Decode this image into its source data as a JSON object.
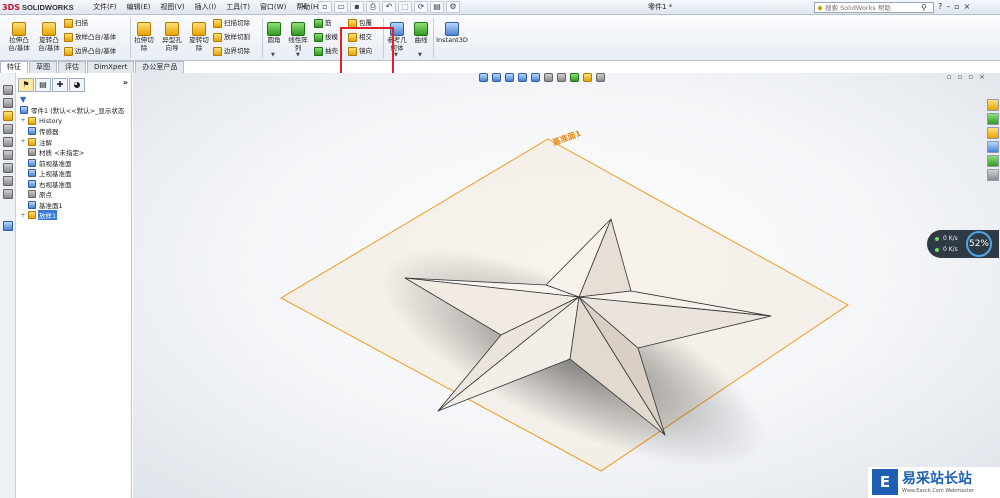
{
  "app": {
    "logo_ds": "3DS",
    "logo_text": "SOLIDWORKS",
    "document_title": "零件1 *"
  },
  "menu": [
    "文件(F)",
    "编辑(E)",
    "视图(V)",
    "插入(I)",
    "工具(T)",
    "窗口(W)",
    "帮助(H)"
  ],
  "menu_more": "⇲",
  "search": {
    "placeholder": "搜索 SolidWorks 帮助"
  },
  "commands": {
    "extrude_boss": "拉伸凸\n台/基体",
    "revolve_boss": "旋转凸\n台/基体",
    "sweep": "扫描",
    "loft_boss": "放样凸台/基体",
    "boundary_boss": "边界凸台/基体",
    "extrude_cut": "拉伸切\n除",
    "hole_wizard": "异型孔\n向导",
    "revolve_cut": "旋转切\n除",
    "swept_cut": "扫描切除",
    "lofted_cut": "放样切割",
    "boundary_cut": "边界切除",
    "fillet": "圆角",
    "linear_pattern": "线性阵\n列",
    "rib": "筋",
    "draft": "拔模",
    "shell": "抽壳",
    "wrap": "包覆",
    "intersect": "相交",
    "mirror": "镜向",
    "ref_geometry": "参考几\n何体",
    "curves": "曲线",
    "instant3d": "Instant3D"
  },
  "tabs": [
    "特征",
    "草图",
    "评估",
    "DimXpert",
    "办公室产品"
  ],
  "active_tab": 0,
  "tree": {
    "root": "零件1 (默认<<默认>_显示状态",
    "items": [
      {
        "label": "History",
        "expand": "+"
      },
      {
        "label": "传感器",
        "expand": ""
      },
      {
        "label": "注解",
        "expand": "+"
      },
      {
        "label": "材质 <未指定>",
        "expand": ""
      },
      {
        "label": "前视基准面",
        "expand": ""
      },
      {
        "label": "上视基准面",
        "expand": ""
      },
      {
        "label": "右视基准面",
        "expand": ""
      },
      {
        "label": "原点",
        "expand": ""
      },
      {
        "label": "基准面1",
        "expand": ""
      },
      {
        "label": "放样1",
        "expand": "+"
      }
    ],
    "selected_index": 9
  },
  "plane_label": "基准面1",
  "performance": {
    "value1": "0 K/s",
    "value2": "0 K/s",
    "percent": "52%"
  },
  "watermark": {
    "text": "易采站长站",
    "url": "Www.Easck.Com  Webmaster"
  }
}
